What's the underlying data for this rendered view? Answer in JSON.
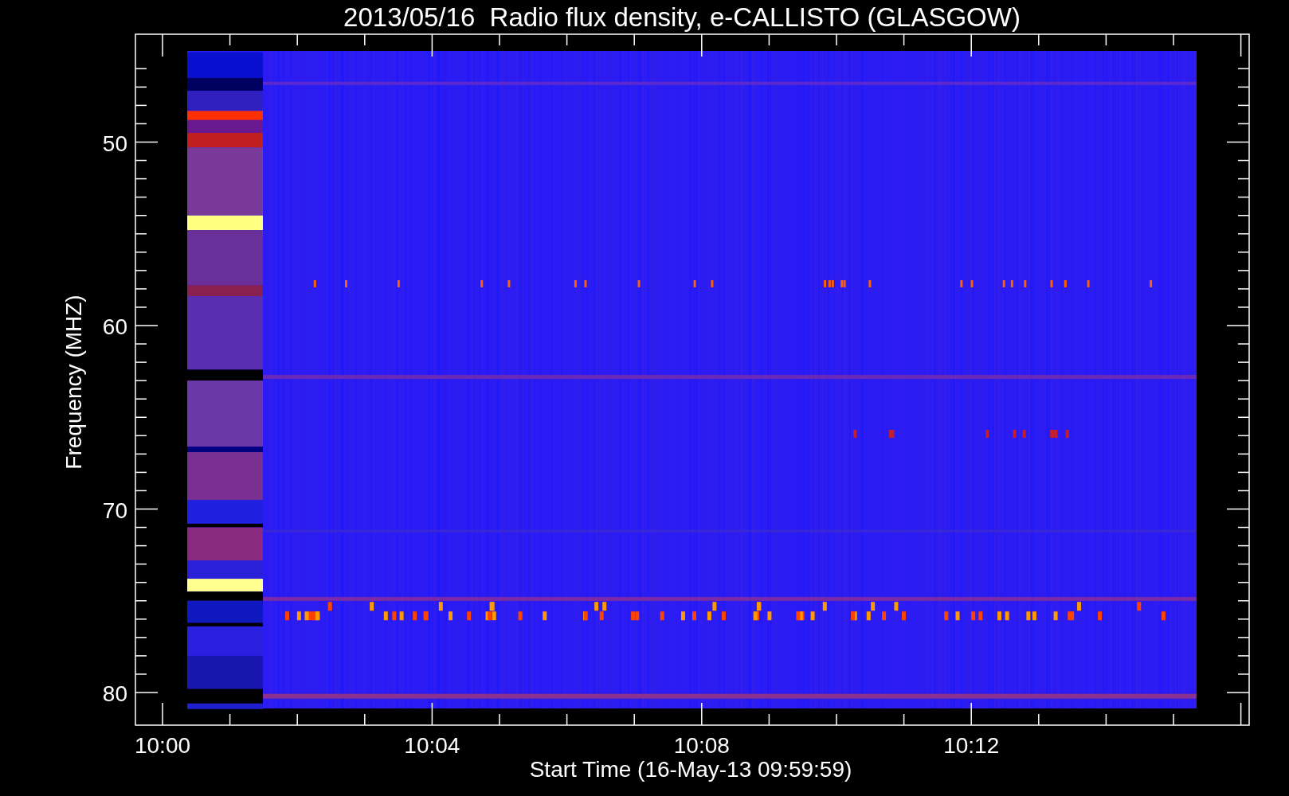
{
  "plot": {
    "title": "2013/05/16  Radio flux density, e-CALLISTO (GLASGOW)",
    "ylabel": "Frequency (MHZ)",
    "xlabel": "Start Time (16-May-13 09:59:59)",
    "yticks": [
      "50",
      "60",
      "70",
      "80"
    ],
    "xticks": [
      "10:00",
      "10:04",
      "10:08",
      "10:12"
    ]
  }
}
